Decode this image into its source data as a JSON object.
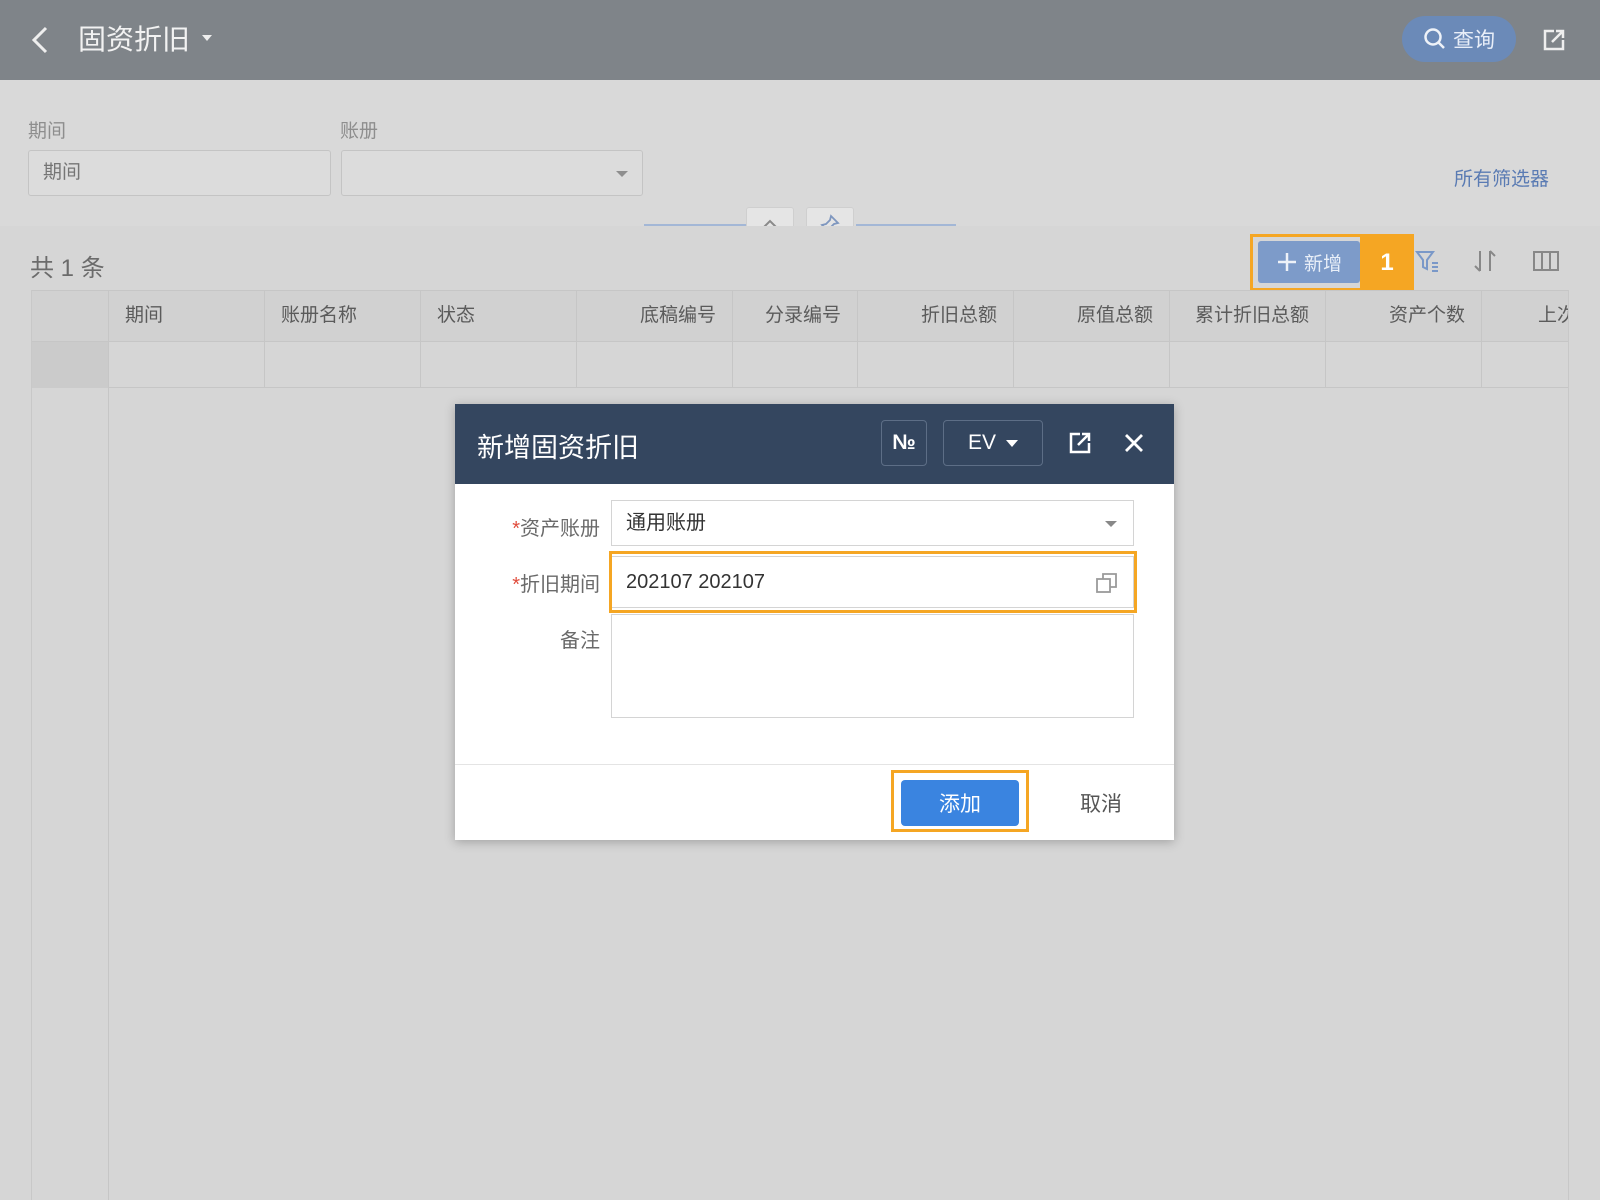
{
  "header": {
    "title": "固资折旧",
    "query_label": "查询"
  },
  "filters": {
    "period_label": "期间",
    "period_placeholder": "期间",
    "ledger_label": "账册",
    "ledger_value": "",
    "all_filters_label": "所有筛选器"
  },
  "list": {
    "total_text": "共 1 条",
    "add_label": "新增",
    "callout_number": "1",
    "columns": [
      "期间",
      "账册名称",
      "状态",
      "底稿编号",
      "分录编号",
      "折旧总额",
      "原值总额",
      "累计折旧总额",
      "资产个数",
      "上次"
    ]
  },
  "dialog": {
    "title": "新增固资折旧",
    "no_label": "№",
    "lang_label": "EV",
    "required_mark": "*",
    "asset_ledger_label": "资产账册",
    "asset_ledger_value": "通用账册",
    "period_label": "折旧期间",
    "period_value": "202107 202107",
    "remark_label": "备注",
    "remark_value": "",
    "ok_label": "添加",
    "cancel_label": "取消"
  },
  "colors": {
    "header_bg": "#7f8489",
    "dialog_header_bg": "#34465f",
    "primary": "#3a84e0",
    "highlight": "#f5a623",
    "required": "#e04b3b"
  }
}
